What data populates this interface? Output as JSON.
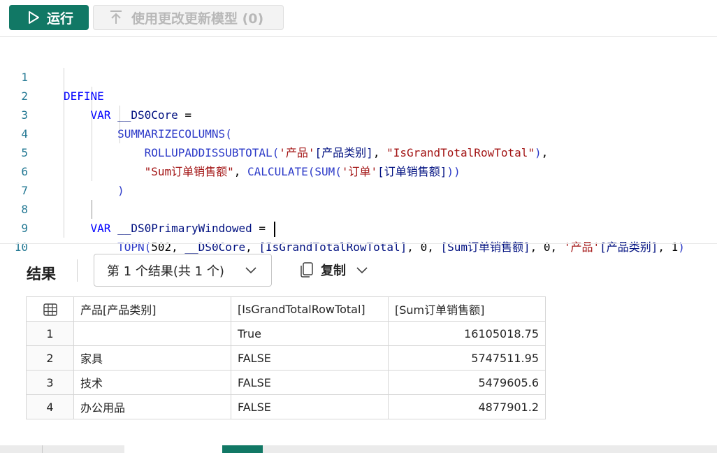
{
  "toolbar": {
    "run_label": "运行",
    "update_label": "使用更改更新模型 (0)"
  },
  "editor": {
    "line_numbers": [
      "1",
      "2",
      "3",
      "4",
      "5",
      "6",
      "7",
      "8",
      "9",
      "10"
    ]
  },
  "results": {
    "title": "结果",
    "selector_value": "第 1 个结果(共 1 个)",
    "copy_label": "复制",
    "columns": [
      "产品[产品类别]",
      "[IsGrandTotalRowTotal]",
      "[Sum订单销售额]"
    ],
    "rows": [
      {
        "index": "1",
        "category": "",
        "is_total": "True",
        "sum": "16105018.75"
      },
      {
        "index": "2",
        "category": "家具",
        "is_total": "FALSE",
        "sum": "5747511.95"
      },
      {
        "index": "3",
        "category": "技术",
        "is_total": "FALSE",
        "sum": "5479605.6"
      },
      {
        "index": "4",
        "category": "办公用品",
        "is_total": "FALSE",
        "sum": "4877901.2"
      }
    ]
  },
  "colors": {
    "run_button": "#117865",
    "keyword": "#0000ff",
    "string": "#a31515",
    "line_number": "#237893"
  }
}
